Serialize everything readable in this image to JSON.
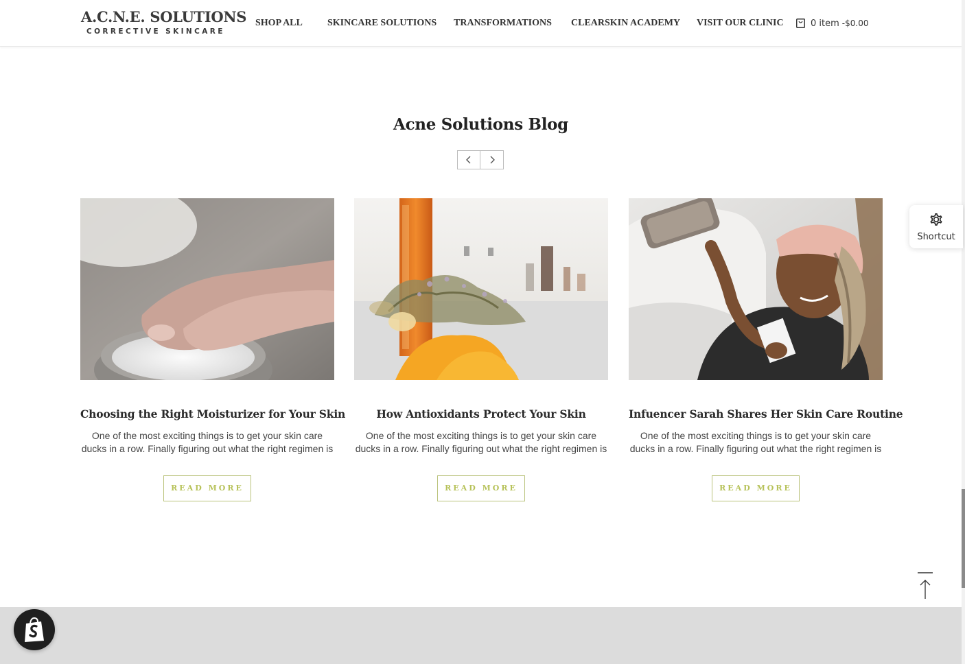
{
  "header": {
    "logo_main": "A.C.N.E. SOLUTIONS",
    "logo_sub": "CORRECTIVE SKINCARE",
    "nav": [
      {
        "label": "SHOP ALL"
      },
      {
        "label": "SKINCARE SOLUTIONS"
      },
      {
        "label": "TRANSFORMATIONS"
      },
      {
        "label": "CLEARSKIN ACADEMY"
      },
      {
        "label": "VISIT OUR CLINIC"
      }
    ],
    "cart": {
      "count_text": "0 item",
      "price_text": "-$0.00",
      "icon": "shopping-bag-icon"
    }
  },
  "blog": {
    "title": "Acne Solutions Blog",
    "prev_icon": "chevron-left-icon",
    "next_icon": "chevron-right-icon",
    "posts": [
      {
        "title": "Choosing the Right Moisturizer for Your Skin",
        "excerpt": "One of the most exciting things is to get your skin care ducks in a row. Finally figuring out what the right regimen is",
        "button": "READ MORE"
      },
      {
        "title": "How Antioxidants Protect Your Skin",
        "excerpt": "One of the most exciting things is to get your skin care ducks in a row. Finally figuring out what the right regimen is",
        "button": "READ MORE"
      },
      {
        "title": "Infuencer Sarah Shares Her Skin Care Routine",
        "excerpt": "One of the most exciting things is to get your skin care ducks in a row. Finally figuring out what the right regimen is",
        "button": "READ MORE"
      }
    ]
  },
  "shortcut": {
    "label": "Shortcut",
    "icon": "gear-icon"
  },
  "back_to_top": {
    "icon": "arrow-up-icon"
  },
  "shopify": {
    "icon": "shopify-bag-icon"
  },
  "colors": {
    "accent": "#b7c25a",
    "footer": "#dcdcdc",
    "text": "#222222"
  }
}
